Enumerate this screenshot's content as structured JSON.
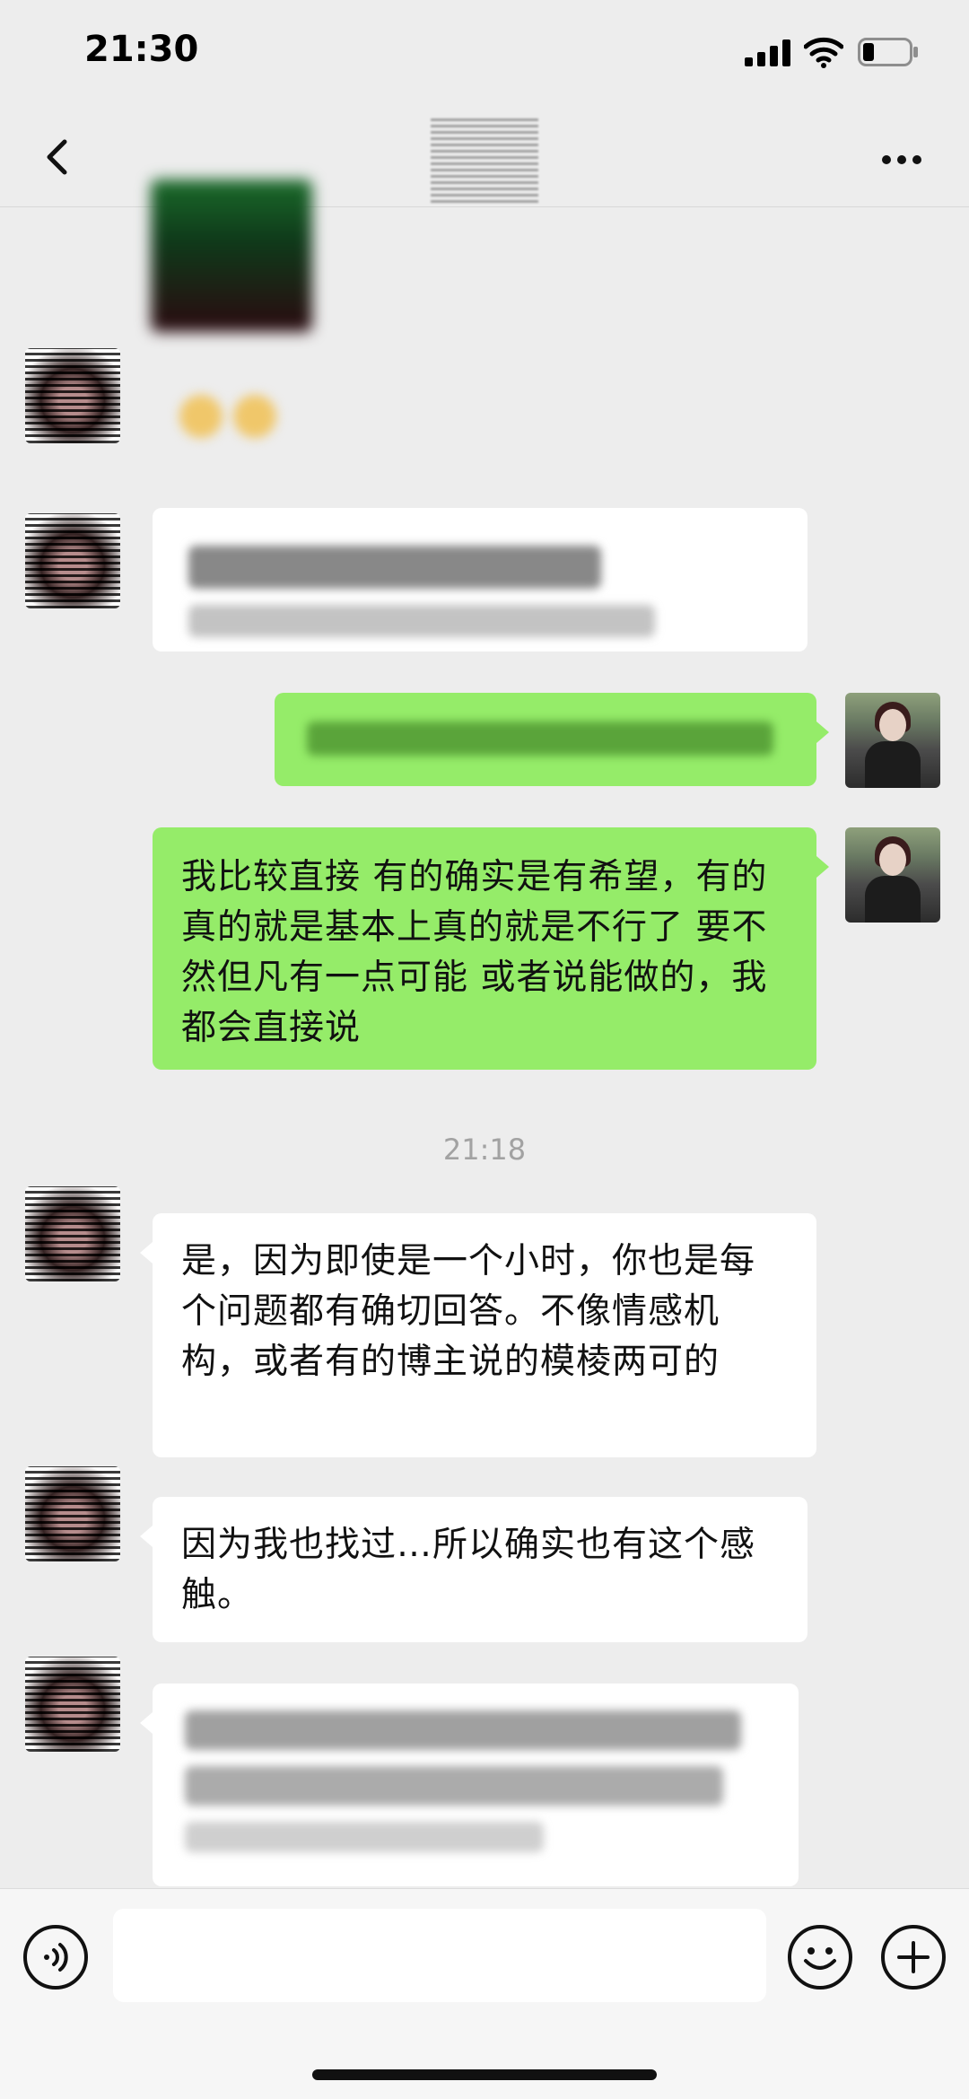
{
  "status_bar": {
    "time": "21:30"
  },
  "icons": {
    "back": "chevron-left-icon",
    "more": "more-icon",
    "voice": "voice-icon",
    "emoji": "emoji-icon",
    "plus": "plus-icon",
    "signal": "signal-icon",
    "wifi": "wifi-icon",
    "battery": "battery-icon"
  },
  "colors": {
    "sent_bubble": "#95ec69",
    "received_bubble": "#ffffff",
    "background": "#ededed"
  },
  "messages": [
    {
      "id": "m1",
      "side": "received",
      "type": "image-blurred"
    },
    {
      "id": "m2",
      "side": "received",
      "type": "emoji-blurred"
    },
    {
      "id": "m3",
      "side": "received",
      "type": "text-blurred"
    },
    {
      "id": "m4",
      "side": "sent",
      "type": "text-blurred"
    },
    {
      "id": "m5",
      "side": "sent",
      "type": "text",
      "text": "我比较直接 有的确实是有希望，有的真的就是基本上真的就是不行了 要不然但凡有一点可能 或者说能做的，我都会直接说"
    },
    {
      "id": "m6",
      "side": "received",
      "type": "text",
      "text": "是，因为即使是一个小时，你也是每个问题都有确切回答。不像情感机构，或者有的博主说的模棱两可的"
    },
    {
      "id": "m7",
      "side": "received",
      "type": "text",
      "text": "因为我也找过…所以确实也有这个感触。"
    },
    {
      "id": "m8",
      "side": "received",
      "type": "text-blurred"
    }
  ],
  "timestamp": "21:18"
}
